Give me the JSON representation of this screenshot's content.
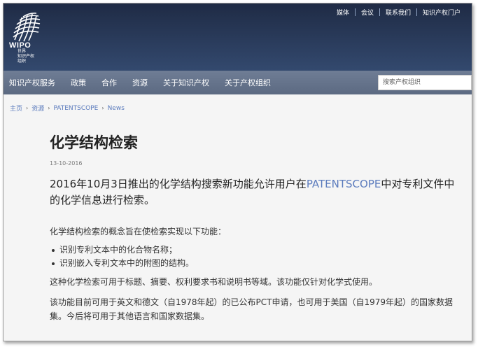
{
  "brand": {
    "logo_wipo": "WIPO",
    "logo_sub_1": "世界",
    "logo_sub_2": "知识产权",
    "logo_sub_3": "组织"
  },
  "top_links": [
    "媒体",
    "会议",
    "联系我们",
    "知识产权门户"
  ],
  "nav": {
    "items": [
      "知识产权服务",
      "政策",
      "合作",
      "资源",
      "关于知识产权",
      "关于产权组织"
    ],
    "search_placeholder": "搜索产权组织"
  },
  "breadcrumb": [
    "主页",
    "资源",
    "PATENTSCOPE",
    "News"
  ],
  "article": {
    "title": "化学结构检索",
    "date": "13-10-2016",
    "lead_before": "2016年10月3日推出的化学结构搜索新功能允许用户在",
    "lead_link": "PATENTSCOPE",
    "lead_after": "中对专利文件中的化学信息进行检索。",
    "p1": "化学结构检索的概念旨在使检索实现以下功能：",
    "bullets": [
      "识别专利文本中的化合物名称；",
      "识别嵌入专利文本中的附图的结构。"
    ],
    "p2": "这种化学检索可用于标题、摘要、权利要求书和说明书等域。该功能仅针对化学式使用。",
    "p3": "该功能目前可用于英文和德文（自1978年起）的已公布PCT申请，也可用于美国（自1979年起）的国家数据集。今后将可用于其他语言和国家数据集。"
  },
  "colors": {
    "header_dark": "#1f2b45",
    "nav_bg": "#64728a",
    "link": "#5b7bbd"
  }
}
